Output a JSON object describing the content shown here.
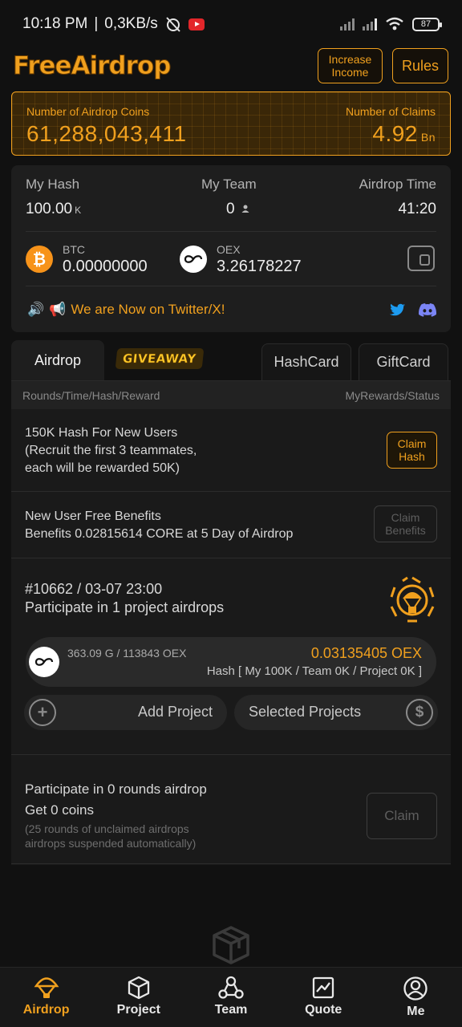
{
  "status_bar": {
    "time": "10:18 PM",
    "net_speed": "0,3KB/s",
    "battery": "87"
  },
  "header": {
    "logo": "FreeAirdrop",
    "increase_income": "Increase Income",
    "rules": "Rules"
  },
  "coins_banner": {
    "airdrop_coins_label": "Number of Airdrop Coins",
    "airdrop_coins_value": "61,288,043,411",
    "claims_label": "Number of Claims",
    "claims_value": "4.92",
    "claims_unit": "Bn"
  },
  "stats": {
    "my_hash_label": "My Hash",
    "my_hash_value": "100.00",
    "my_hash_unit": "K",
    "my_team_label": "My Team",
    "my_team_value": "0",
    "airdrop_time_label": "Airdrop Time",
    "airdrop_time_value": "41:20"
  },
  "balances": {
    "btc_label": "BTC",
    "btc_value": "0.00000000",
    "oex_label": "OEX",
    "oex_value": "3.26178227"
  },
  "announcement": "We are Now on Twitter/X!",
  "tabs": {
    "airdrop": "Airdrop",
    "giveaway": "GIVEAWAY",
    "hashcard": "HashCard",
    "giftcard": "GiftCard"
  },
  "table_head": {
    "left": "Rounds/Time/Hash/Reward",
    "right": "MyRewards/Status"
  },
  "rows": {
    "new_user_hash_line1": "150K Hash For New Users",
    "new_user_hash_line2": "(Recruit the first 3 teammates,",
    "new_user_hash_line3": "each will be rewarded 50K)",
    "claim_hash": "Claim Hash",
    "free_benefits_line1": "New User Free Benefits",
    "free_benefits_line2": "Benefits 0.02815614 CORE at 5 Day of Airdrop",
    "claim_benefits": "Claim Benefits"
  },
  "round": {
    "id_time": "#10662 / 03-07 23:00",
    "participate": "Participate in 1 project airdrops",
    "project_amount": "363.09 G / 113843 OEX",
    "project_reward": "0.03135405 OEX",
    "project_hash": "Hash [ My 100K / Team 0K / Project 0K ]",
    "add_project": "Add Project",
    "selected_projects": "Selected Projects"
  },
  "summary": {
    "rounds": "Participate in 0 rounds airdrop",
    "coins": "Get 0 coins",
    "note_line1": "(25 rounds of unclaimed airdrops",
    "note_line2": "airdrops suspended automatically)",
    "claim": "Claim"
  },
  "nav": {
    "airdrop": "Airdrop",
    "project": "Project",
    "team": "Team",
    "quote": "Quote",
    "me": "Me"
  },
  "colors": {
    "accent": "#f0a01e",
    "background": "#111111",
    "card": "#1e1e1e"
  }
}
